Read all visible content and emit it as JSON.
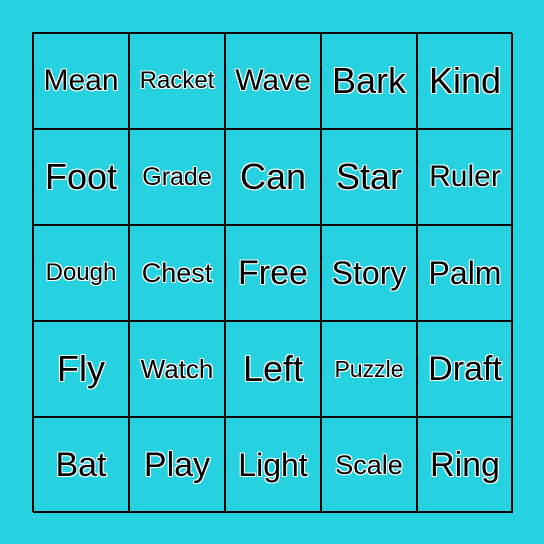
{
  "colors": {
    "background": "#26d2e0",
    "grid_lines": "#000000",
    "text": "#000000",
    "text_outline": "#ffffff"
  },
  "cells": [
    [
      "Mean",
      "Racket",
      "Wave",
      "Bark",
      "Kind"
    ],
    [
      "Foot",
      "Grade",
      "Can",
      "Star",
      "Ruler"
    ],
    [
      "Dough",
      "Chest",
      "Free",
      "Story",
      "Palm"
    ],
    [
      "Fly",
      "Watch",
      "Left",
      "Puzzle",
      "Draft"
    ],
    [
      "Bat",
      "Play",
      "Light",
      "Scale",
      "Ring"
    ]
  ]
}
